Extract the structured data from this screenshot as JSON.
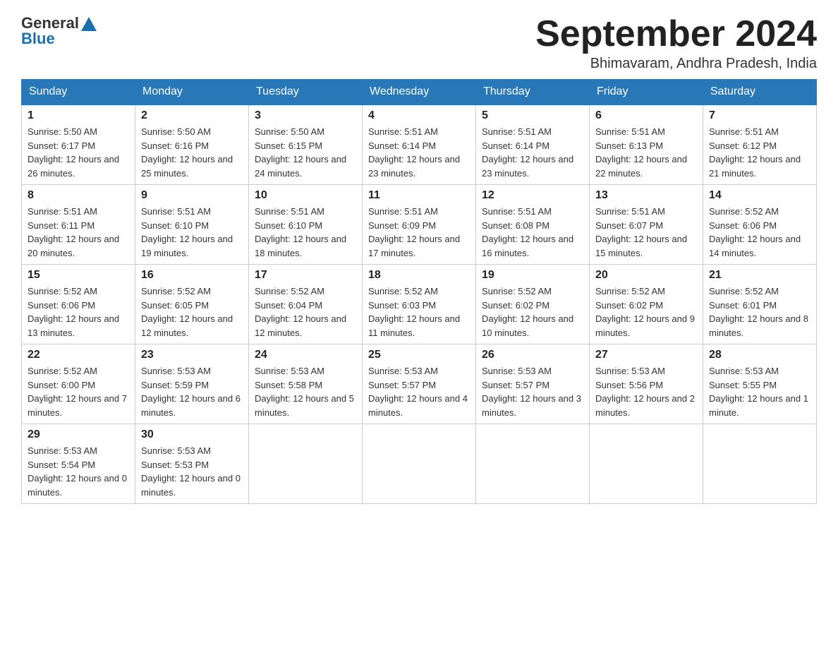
{
  "logo": {
    "general": "General",
    "blue": "Blue"
  },
  "title": "September 2024",
  "location": "Bhimavaram, Andhra Pradesh, India",
  "days_of_week": [
    "Sunday",
    "Monday",
    "Tuesday",
    "Wednesday",
    "Thursday",
    "Friday",
    "Saturday"
  ],
  "weeks": [
    [
      {
        "day": "1",
        "sunrise": "5:50 AM",
        "sunset": "6:17 PM",
        "daylight": "12 hours and 26 minutes."
      },
      {
        "day": "2",
        "sunrise": "5:50 AM",
        "sunset": "6:16 PM",
        "daylight": "12 hours and 25 minutes."
      },
      {
        "day": "3",
        "sunrise": "5:50 AM",
        "sunset": "6:15 PM",
        "daylight": "12 hours and 24 minutes."
      },
      {
        "day": "4",
        "sunrise": "5:51 AM",
        "sunset": "6:14 PM",
        "daylight": "12 hours and 23 minutes."
      },
      {
        "day": "5",
        "sunrise": "5:51 AM",
        "sunset": "6:14 PM",
        "daylight": "12 hours and 23 minutes."
      },
      {
        "day": "6",
        "sunrise": "5:51 AM",
        "sunset": "6:13 PM",
        "daylight": "12 hours and 22 minutes."
      },
      {
        "day": "7",
        "sunrise": "5:51 AM",
        "sunset": "6:12 PM",
        "daylight": "12 hours and 21 minutes."
      }
    ],
    [
      {
        "day": "8",
        "sunrise": "5:51 AM",
        "sunset": "6:11 PM",
        "daylight": "12 hours and 20 minutes."
      },
      {
        "day": "9",
        "sunrise": "5:51 AM",
        "sunset": "6:10 PM",
        "daylight": "12 hours and 19 minutes."
      },
      {
        "day": "10",
        "sunrise": "5:51 AM",
        "sunset": "6:10 PM",
        "daylight": "12 hours and 18 minutes."
      },
      {
        "day": "11",
        "sunrise": "5:51 AM",
        "sunset": "6:09 PM",
        "daylight": "12 hours and 17 minutes."
      },
      {
        "day": "12",
        "sunrise": "5:51 AM",
        "sunset": "6:08 PM",
        "daylight": "12 hours and 16 minutes."
      },
      {
        "day": "13",
        "sunrise": "5:51 AM",
        "sunset": "6:07 PM",
        "daylight": "12 hours and 15 minutes."
      },
      {
        "day": "14",
        "sunrise": "5:52 AM",
        "sunset": "6:06 PM",
        "daylight": "12 hours and 14 minutes."
      }
    ],
    [
      {
        "day": "15",
        "sunrise": "5:52 AM",
        "sunset": "6:06 PM",
        "daylight": "12 hours and 13 minutes."
      },
      {
        "day": "16",
        "sunrise": "5:52 AM",
        "sunset": "6:05 PM",
        "daylight": "12 hours and 12 minutes."
      },
      {
        "day": "17",
        "sunrise": "5:52 AM",
        "sunset": "6:04 PM",
        "daylight": "12 hours and 12 minutes."
      },
      {
        "day": "18",
        "sunrise": "5:52 AM",
        "sunset": "6:03 PM",
        "daylight": "12 hours and 11 minutes."
      },
      {
        "day": "19",
        "sunrise": "5:52 AM",
        "sunset": "6:02 PM",
        "daylight": "12 hours and 10 minutes."
      },
      {
        "day": "20",
        "sunrise": "5:52 AM",
        "sunset": "6:02 PM",
        "daylight": "12 hours and 9 minutes."
      },
      {
        "day": "21",
        "sunrise": "5:52 AM",
        "sunset": "6:01 PM",
        "daylight": "12 hours and 8 minutes."
      }
    ],
    [
      {
        "day": "22",
        "sunrise": "5:52 AM",
        "sunset": "6:00 PM",
        "daylight": "12 hours and 7 minutes."
      },
      {
        "day": "23",
        "sunrise": "5:53 AM",
        "sunset": "5:59 PM",
        "daylight": "12 hours and 6 minutes."
      },
      {
        "day": "24",
        "sunrise": "5:53 AM",
        "sunset": "5:58 PM",
        "daylight": "12 hours and 5 minutes."
      },
      {
        "day": "25",
        "sunrise": "5:53 AM",
        "sunset": "5:57 PM",
        "daylight": "12 hours and 4 minutes."
      },
      {
        "day": "26",
        "sunrise": "5:53 AM",
        "sunset": "5:57 PM",
        "daylight": "12 hours and 3 minutes."
      },
      {
        "day": "27",
        "sunrise": "5:53 AM",
        "sunset": "5:56 PM",
        "daylight": "12 hours and 2 minutes."
      },
      {
        "day": "28",
        "sunrise": "5:53 AM",
        "sunset": "5:55 PM",
        "daylight": "12 hours and 1 minute."
      }
    ],
    [
      {
        "day": "29",
        "sunrise": "5:53 AM",
        "sunset": "5:54 PM",
        "daylight": "12 hours and 0 minutes."
      },
      {
        "day": "30",
        "sunrise": "5:53 AM",
        "sunset": "5:53 PM",
        "daylight": "12 hours and 0 minutes."
      },
      null,
      null,
      null,
      null,
      null
    ]
  ]
}
